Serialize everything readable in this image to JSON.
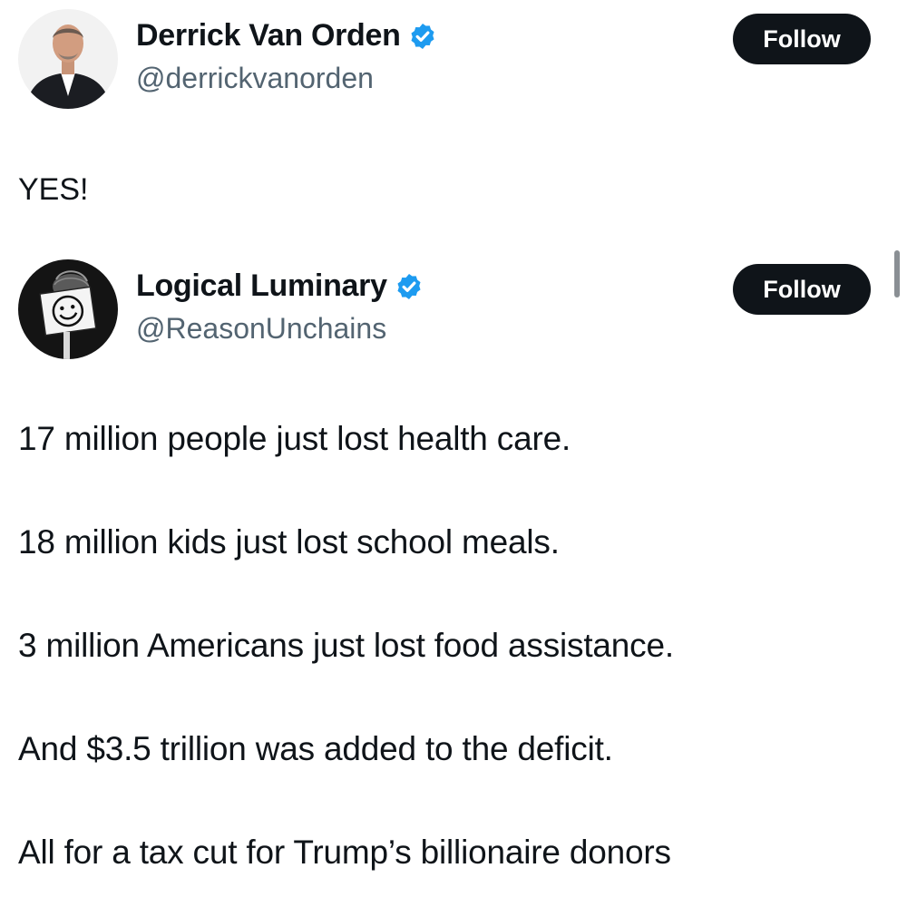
{
  "post": {
    "author": {
      "display_name": "Derrick Van Orden",
      "handle": "@derrickvanorden",
      "verified": true,
      "avatar": "man-in-suit-avatar"
    },
    "follow_label": "Follow",
    "text": "YES!"
  },
  "quoted_post": {
    "author": {
      "display_name": "Logical Luminary",
      "handle": "@ReasonUnchains",
      "verified": true,
      "avatar": "smiley-face-sign-avatar"
    },
    "follow_label": "Follow",
    "lines": [
      "17 million people just lost health care.",
      "18 million kids just lost school meals.",
      "3 million Americans just lost food assistance.",
      "And $3.5 trillion was added to the deficit.",
      "All for a tax cut for Trump’s billionaire donors"
    ]
  },
  "colors": {
    "text_primary": "#0f1419",
    "text_secondary": "#536471",
    "verified_blue": "#1d9bf0",
    "follow_button_bg": "#0f1419",
    "follow_button_text": "#ffffff"
  }
}
